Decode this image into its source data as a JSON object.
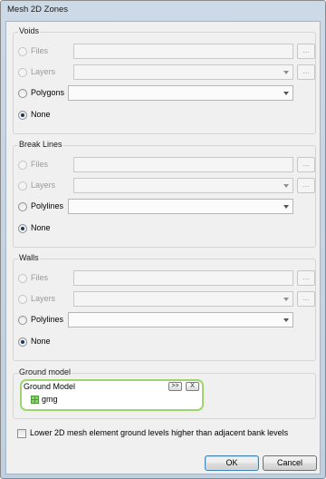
{
  "window": {
    "title": "Mesh 2D Zones"
  },
  "voids": {
    "title": "Voids",
    "options": [
      {
        "label": "Files",
        "checked": false,
        "enabled": false
      },
      {
        "label": "Layers",
        "checked": false,
        "enabled": false
      },
      {
        "label": "Polygons",
        "checked": false,
        "enabled": true
      },
      {
        "label": "None",
        "checked": true,
        "enabled": true
      }
    ],
    "browse_label": "..."
  },
  "break_lines": {
    "title": "Break Lines",
    "options": [
      {
        "label": "Files",
        "checked": false,
        "enabled": false
      },
      {
        "label": "Layers",
        "checked": false,
        "enabled": false
      },
      {
        "label": "Polylines",
        "checked": false,
        "enabled": true
      },
      {
        "label": "None",
        "checked": true,
        "enabled": true
      }
    ],
    "browse_label": "..."
  },
  "walls": {
    "title": "Walls",
    "options": [
      {
        "label": "Files",
        "checked": false,
        "enabled": false
      },
      {
        "label": "Layers",
        "checked": false,
        "enabled": false
      },
      {
        "label": "Polylines",
        "checked": false,
        "enabled": true
      },
      {
        "label": "None",
        "checked": true,
        "enabled": true
      }
    ],
    "browse_label": "..."
  },
  "ground_model": {
    "title": "Ground model",
    "box_label": "Ground Model",
    "add_button": ">>",
    "remove_button": "X",
    "item": "gmg",
    "icon": "grid-icon"
  },
  "lower_levels": {
    "label": "Lower 2D mesh  element ground levels higher than adjacent bank levels",
    "checked": false
  },
  "buttons": {
    "ok": "OK",
    "cancel": "Cancel"
  }
}
